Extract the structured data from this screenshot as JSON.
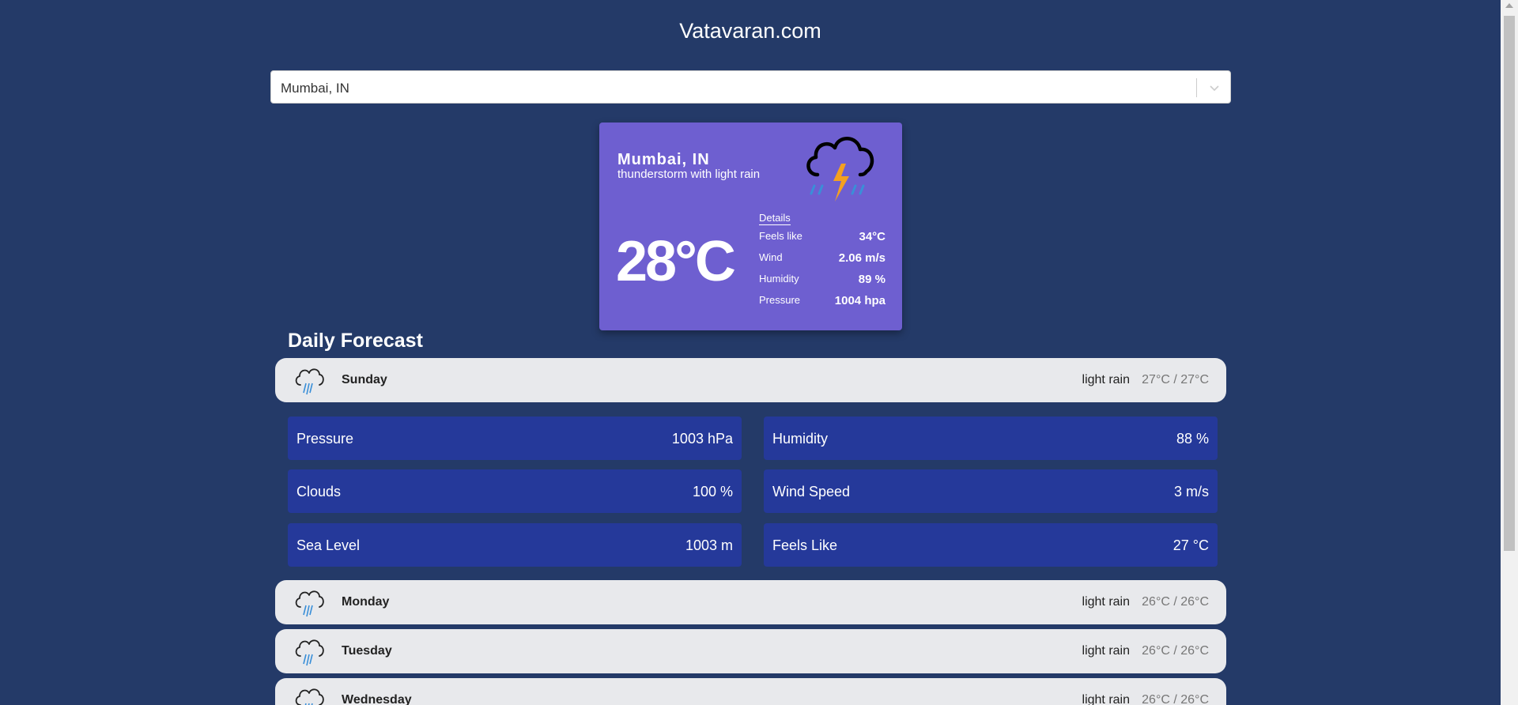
{
  "site": {
    "title": "Vatavaran.com"
  },
  "search": {
    "value": "Mumbai, IN"
  },
  "current": {
    "city": "Mumbai, IN",
    "description": "thunderstorm with light rain",
    "icon": "thunderstorm-rain-icon",
    "temperature": "28°C",
    "details_title": "Details",
    "details": [
      {
        "label": "Feels like",
        "value": "34°C"
      },
      {
        "label": "Wind",
        "value": "2.06 m/s"
      },
      {
        "label": "Humidity",
        "value": "89 %"
      },
      {
        "label": "Pressure",
        "value": "1004 hpa"
      }
    ]
  },
  "forecast": {
    "heading": "Daily Forecast",
    "days": [
      {
        "day": "Sunday",
        "description": "light rain",
        "temp": "27°C / 27°C",
        "icon": "rain-cloud-icon",
        "expanded": true
      },
      {
        "day": "Monday",
        "description": "light rain",
        "temp": "26°C / 26°C",
        "icon": "rain-cloud-icon"
      },
      {
        "day": "Tuesday",
        "description": "light rain",
        "temp": "26°C / 26°C",
        "icon": "rain-cloud-icon"
      },
      {
        "day": "Wednesday",
        "description": "light rain",
        "temp": "26°C / 26°C",
        "icon": "rain-cloud-icon"
      }
    ],
    "expanded_details": [
      {
        "label": "Pressure",
        "value": "1003 hPa"
      },
      {
        "label": "Humidity",
        "value": "88 %"
      },
      {
        "label": "Clouds",
        "value": "100 %"
      },
      {
        "label": "Wind Speed",
        "value": "3 m/s"
      },
      {
        "label": "Sea Level",
        "value": "1003 m"
      },
      {
        "label": "Feels Like",
        "value": "27 °C"
      }
    ]
  },
  "colors": {
    "background": "#243a68",
    "card": "#6e5fd0",
    "stat_box": "#25399a",
    "day_row": "#e8e9ec",
    "lightning": "#f4a020",
    "rain": "#3a8fd8"
  }
}
